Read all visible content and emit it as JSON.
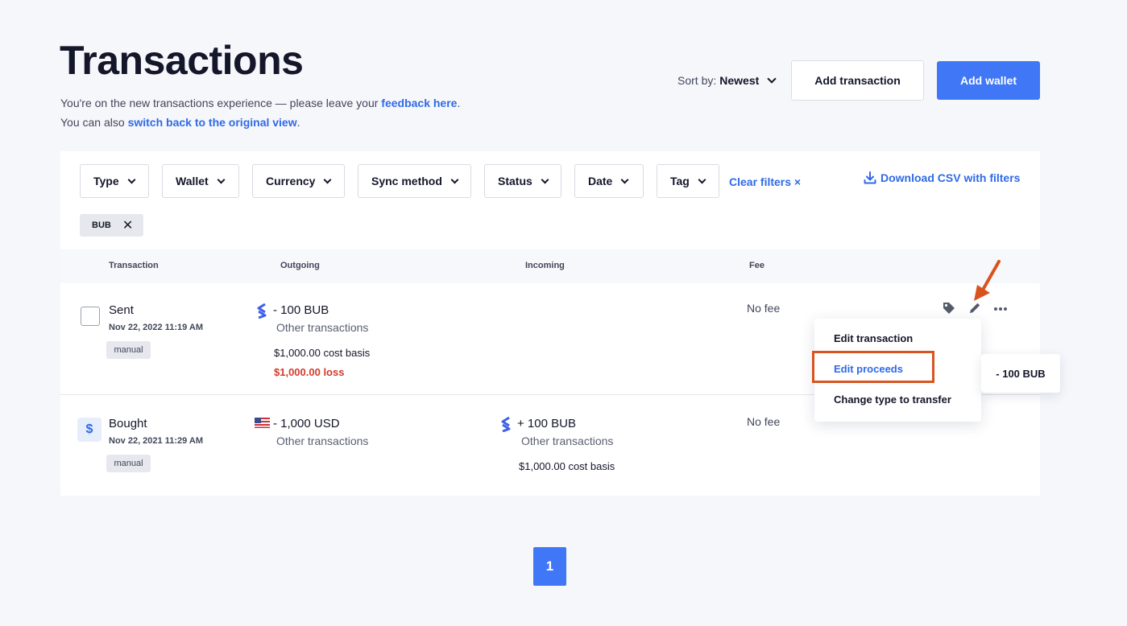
{
  "header": {
    "title": "Transactions",
    "sub1_prefix": "You're on the new transactions experience — please leave your ",
    "sub1_link": "feedback here",
    "sub1_suffix": ".",
    "sub2_prefix": "You can also ",
    "sub2_link": "switch back to the original view",
    "sub2_suffix": ".",
    "sort_label": "Sort by:",
    "sort_value": "Newest",
    "add_transaction": "Add transaction",
    "add_wallet": "Add wallet"
  },
  "filters": {
    "items": [
      "Type",
      "Wallet",
      "Currency",
      "Sync method",
      "Status",
      "Date",
      "Tag"
    ],
    "clear": "Clear filters ×",
    "download": "Download CSV with filters",
    "chip": "BUB"
  },
  "table": {
    "headers": [
      "Transaction",
      "Outgoing",
      "Incoming",
      "Fee"
    ]
  },
  "rows": [
    {
      "type": "Sent",
      "date": "Nov 22, 2022 11:19 AM",
      "tag": "manual",
      "outgoing_amount": "- 100 BUB",
      "outgoing_label": "Other transactions",
      "cost_basis": "$1,000.00 cost basis",
      "gain_loss": "$1,000.00 loss",
      "fee": "No fee"
    },
    {
      "type": "Bought",
      "date": "Nov 22, 2021 11:29 AM",
      "tag": "manual",
      "outgoing_amount": "- 1,000 USD",
      "outgoing_label": "Other transactions",
      "incoming_amount": "+ 100 BUB",
      "incoming_label": "Other transactions",
      "incoming_cost_basis": "$1,000.00 cost basis",
      "fee": "No fee"
    }
  ],
  "menu": {
    "items": [
      "Edit transaction",
      "Edit proceeds",
      "Change type to transfer"
    ]
  },
  "tooltip": "- 100 BUB",
  "pagination": {
    "current": "1"
  },
  "colors": {
    "accent": "#3f77f6",
    "link": "#2f6ae6",
    "loss": "#d33a2c",
    "annotation": "#d8541f"
  }
}
